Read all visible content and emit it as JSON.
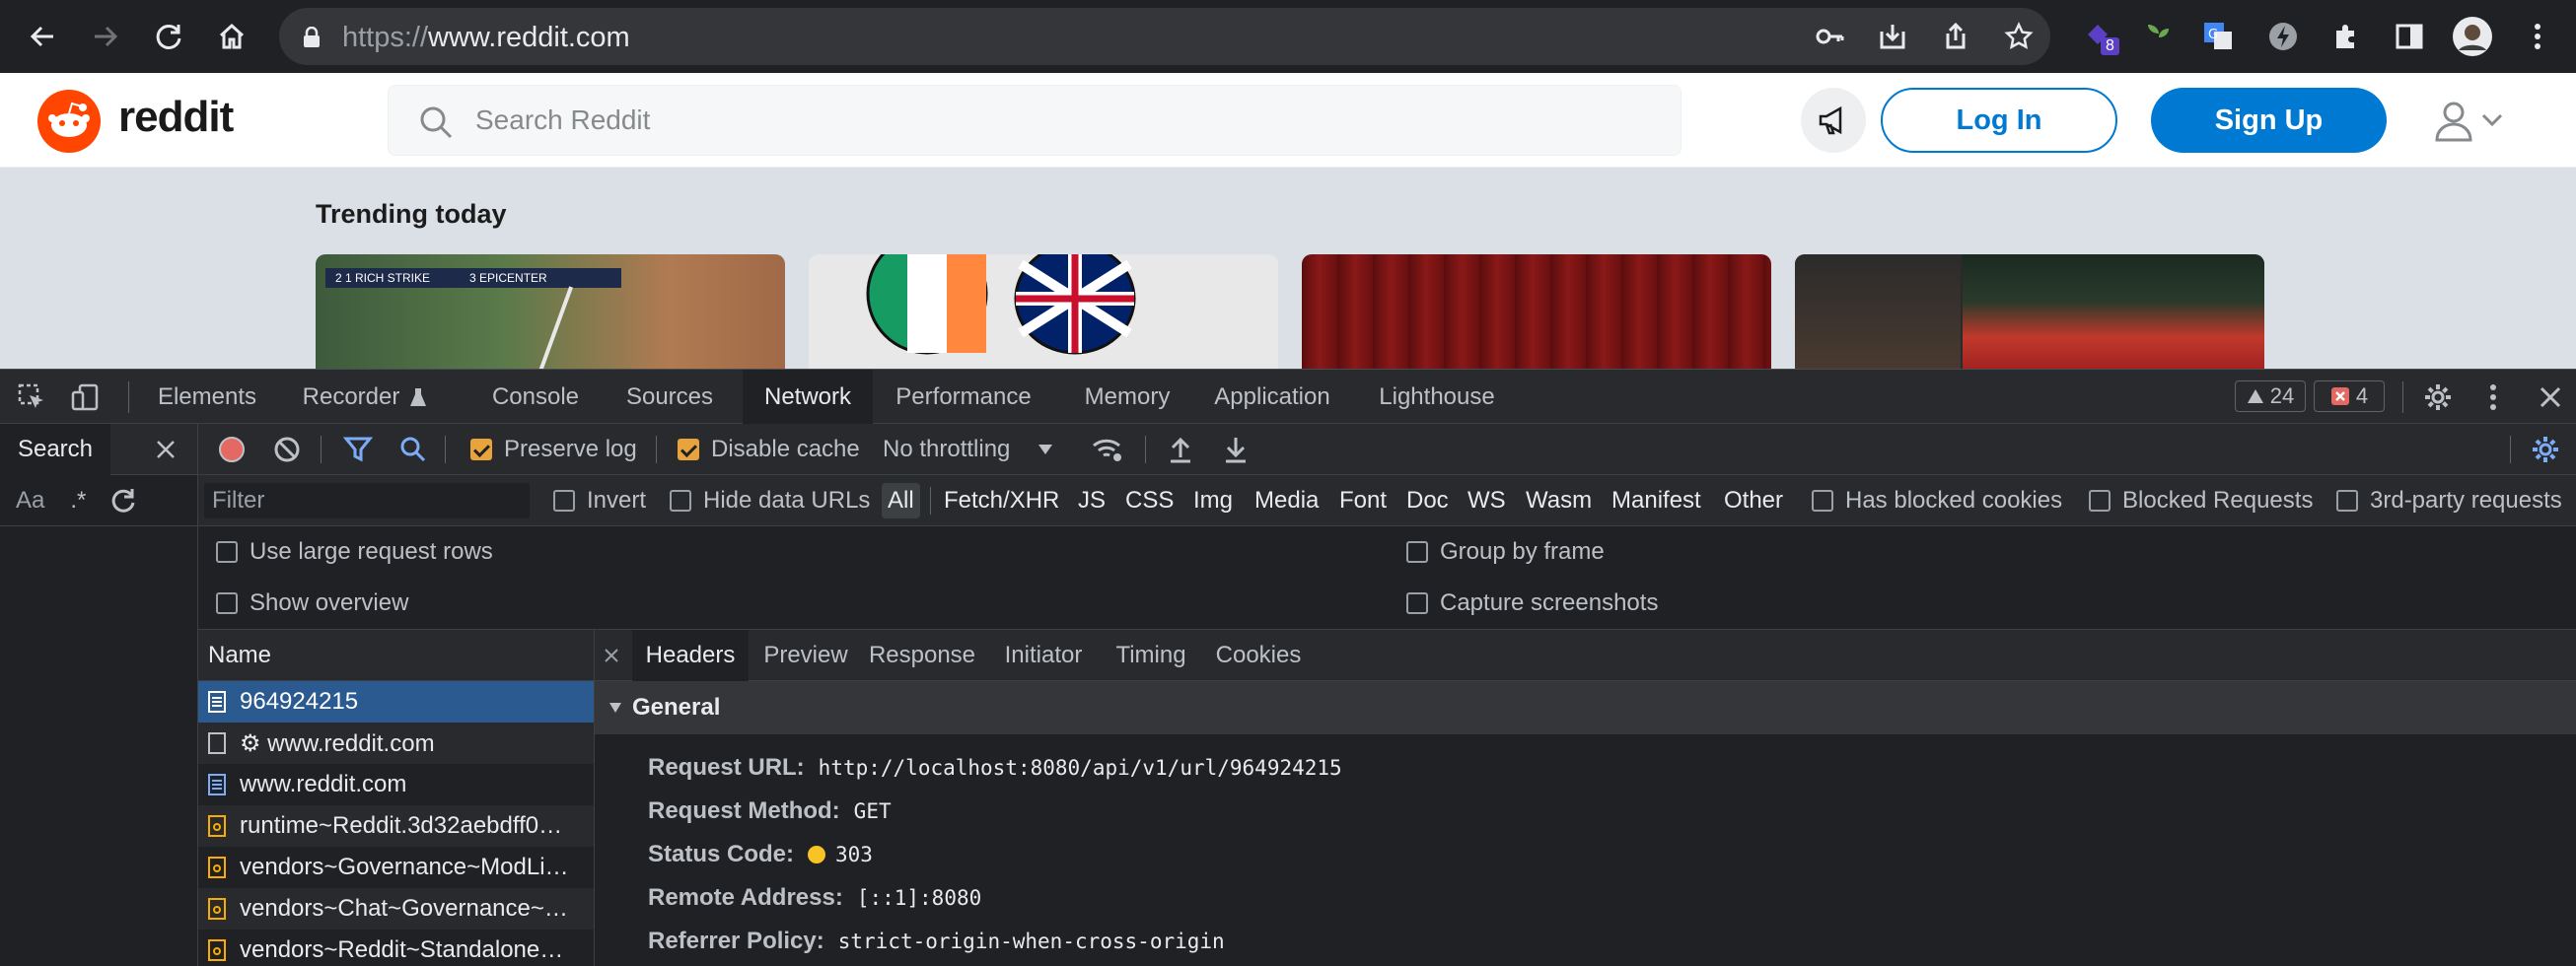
{
  "browser": {
    "url_scheme": "https://",
    "url_host": "www.reddit.com",
    "extension_badge": "8"
  },
  "reddit": {
    "logo_text": "reddit",
    "search_placeholder": "Search Reddit",
    "login_label": "Log In",
    "signup_label": "Sign Up",
    "trending_title": "Trending today",
    "cards": [
      {
        "caption_left": "2 1 RICH STRIKE",
        "caption_right": "3 EPICENTER"
      },
      {
        "caption": ""
      },
      {
        "caption": ""
      },
      {
        "caption": ""
      }
    ]
  },
  "devtools": {
    "tabs": [
      "Elements",
      "Recorder",
      "Console",
      "Sources",
      "Network",
      "Performance",
      "Memory",
      "Application",
      "Lighthouse"
    ],
    "active_tab": "Network",
    "warnings": "24",
    "errors": "4",
    "search_tab": "Search",
    "search_aa": "Aa",
    "search_regex": ".*",
    "toolbar": {
      "preserve_log": "Preserve log",
      "disable_cache": "Disable cache",
      "throttling": "No throttling"
    },
    "filter": {
      "placeholder": "Filter",
      "invert": "Invert",
      "hide_data_urls": "Hide data URLs",
      "types": [
        "All",
        "Fetch/XHR",
        "JS",
        "CSS",
        "Img",
        "Media",
        "Font",
        "Doc",
        "WS",
        "Wasm",
        "Manifest",
        "Other"
      ],
      "has_blocked_cookies": "Has blocked cookies",
      "blocked_requests": "Blocked Requests",
      "third_party": "3rd-party requests"
    },
    "settings": {
      "large_rows": "Use large request rows",
      "group_by_frame": "Group by frame",
      "show_overview": "Show overview",
      "capture_screenshots": "Capture screenshots"
    },
    "requests": {
      "header": "Name",
      "rows": [
        "964924215",
        "⚙ www.reddit.com",
        "www.reddit.com",
        "runtime~Reddit.3d32aebdff0…",
        "vendors~Governance~ModLi…",
        "vendors~Chat~Governance~…",
        "vendors~Reddit~Standalone…"
      ]
    },
    "detail": {
      "tabs": [
        "Headers",
        "Preview",
        "Response",
        "Initiator",
        "Timing",
        "Cookies"
      ],
      "active_tab": "Headers",
      "section": "General",
      "fields": [
        {
          "key": "Request URL:",
          "value": "http://localhost:8080/api/v1/url/964924215"
        },
        {
          "key": "Request Method:",
          "value": "GET"
        },
        {
          "key": "Status Code:",
          "value": "303"
        },
        {
          "key": "Remote Address:",
          "value": "[::1]:8080"
        },
        {
          "key": "Referrer Policy:",
          "value": "strict-origin-when-cross-origin"
        }
      ]
    }
  }
}
